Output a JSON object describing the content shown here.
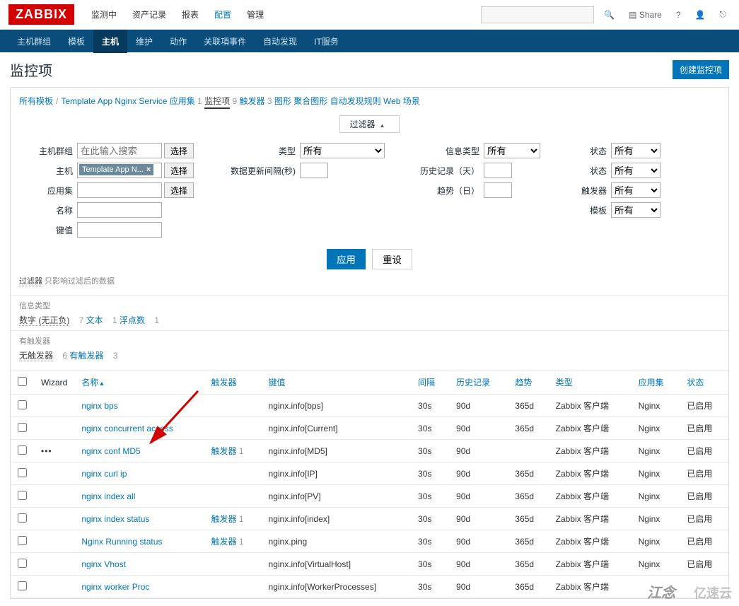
{
  "header": {
    "logo": "ZABBIX",
    "topnav": [
      "监测中",
      "资产记录",
      "报表",
      "配置",
      "管理"
    ],
    "topnav_active": 3,
    "share": "Share",
    "help": "?",
    "user": "👤",
    "logout": "⎋"
  },
  "subnav": {
    "items": [
      "主机群组",
      "模板",
      "主机",
      "维护",
      "动作",
      "关联項事件",
      "自动发现",
      "IT服务"
    ],
    "active": 2
  },
  "page": {
    "title": "监控项",
    "create_btn": "创建监控项"
  },
  "breadcrumb": {
    "items": [
      {
        "label": "所有模板",
        "link": true
      },
      {
        "label": "Template App Nginx Service",
        "link": true
      },
      {
        "label": "应用集",
        "count": "1",
        "link": true
      },
      {
        "label": "监控项",
        "count": "9",
        "link": true,
        "current": true
      },
      {
        "label": "触发器",
        "count": "3",
        "link": true
      },
      {
        "label": "图形",
        "link": true
      },
      {
        "label": "聚合图形",
        "link": true
      },
      {
        "label": "自动发现规则",
        "link": true
      },
      {
        "label": "Web 场景",
        "link": true
      }
    ]
  },
  "filter": {
    "toggle": "过滤器",
    "labels": {
      "hostgroup": "主机群组",
      "host": "主机",
      "appset": "应用集",
      "name": "名称",
      "key": "键值",
      "type": "类型",
      "interval": "数据更新间隔(秒)",
      "infotype": "信息类型",
      "history": "历史记录（天）",
      "trend": "趋势（日）",
      "state": "状态",
      "status": "状态",
      "triggers": "触发器",
      "template": "模板"
    },
    "values": {
      "hostgroup_placeholder": "在此输入搜索",
      "host_tag": "Template App N...",
      "select_btn": "选择",
      "type_all": "所有"
    },
    "actions": {
      "apply": "应用",
      "reset": "重设"
    },
    "hint": "过滤器 只影响过滤后的数据",
    "hint_prefix": "过滤器",
    "hint_suffix": " 只影响过滤后的数据"
  },
  "sub1": {
    "header": "信息类型",
    "items": [
      {
        "label": "数字 (无正负)",
        "count": "7",
        "dim": true
      },
      {
        "label": "文本",
        "count": "1"
      },
      {
        "label": "浮点数",
        "count": "1"
      }
    ]
  },
  "sub2": {
    "header": "有触发器",
    "items": [
      {
        "label": "无触发器",
        "count": "6",
        "dim": true
      },
      {
        "label": "有触发器",
        "count": "3"
      }
    ]
  },
  "table": {
    "headers": [
      "Wizard",
      "名称",
      "触发器",
      "键值",
      "间隔",
      "历史记录",
      "趋势",
      "类型",
      "应用集",
      "状态"
    ],
    "rows": [
      {
        "wizard": "",
        "name": "nginx bps",
        "trigger": "",
        "key": "nginx.info[bps]",
        "interval": "30s",
        "history": "90d",
        "trend": "365d",
        "type": "Zabbix 客户端",
        "appset": "Nginx",
        "status": "已启用"
      },
      {
        "wizard": "",
        "name": "nginx concurrent access",
        "trigger": "",
        "key": "nginx.info[Current]",
        "interval": "30s",
        "history": "90d",
        "trend": "365d",
        "type": "Zabbix 客户端",
        "appset": "Nginx",
        "status": "已启用"
      },
      {
        "wizard": "•••",
        "name": "nginx conf MD5",
        "trigger": "触发器 1",
        "key": "nginx.info[MD5]",
        "interval": "30s",
        "history": "90d",
        "trend": "",
        "type": "Zabbix 客户端",
        "appset": "Nginx",
        "status": "已启用"
      },
      {
        "wizard": "",
        "name": "nginx curl ip",
        "trigger": "",
        "key": "nginx.info[IP]",
        "interval": "30s",
        "history": "90d",
        "trend": "365d",
        "type": "Zabbix 客户端",
        "appset": "Nginx",
        "status": "已启用"
      },
      {
        "wizard": "",
        "name": "nginx index all",
        "trigger": "",
        "key": "nginx.info[PV]",
        "interval": "30s",
        "history": "90d",
        "trend": "365d",
        "type": "Zabbix 客户端",
        "appset": "Nginx",
        "status": "已启用"
      },
      {
        "wizard": "",
        "name": "nginx index status",
        "trigger": "触发器 1",
        "key": "nginx.info[index]",
        "interval": "30s",
        "history": "90d",
        "trend": "365d",
        "type": "Zabbix 客户端",
        "appset": "Nginx",
        "status": "已启用"
      },
      {
        "wizard": "",
        "name": "Nginx Running status",
        "trigger": "触发器 1",
        "key": "nginx.ping",
        "interval": "30s",
        "history": "90d",
        "trend": "365d",
        "type": "Zabbix 客户端",
        "appset": "Nginx",
        "status": "已启用",
        "highlight": true
      },
      {
        "wizard": "",
        "name": "nginx Vhost",
        "trigger": "",
        "key": "nginx.info[VirtualHost]",
        "interval": "30s",
        "history": "90d",
        "trend": "365d",
        "type": "Zabbix 客户端",
        "appset": "Nginx",
        "status": "已启用"
      },
      {
        "wizard": "",
        "name": "nginx worker Proc",
        "trigger": "",
        "key": "nginx.info[WorkerProcesses]",
        "interval": "30s",
        "history": "90d",
        "trend": "365d",
        "type": "Zabbix 客户端",
        "appset": "",
        "status": ""
      }
    ]
  },
  "watermark1": "江念",
  "watermark2": "亿速云"
}
